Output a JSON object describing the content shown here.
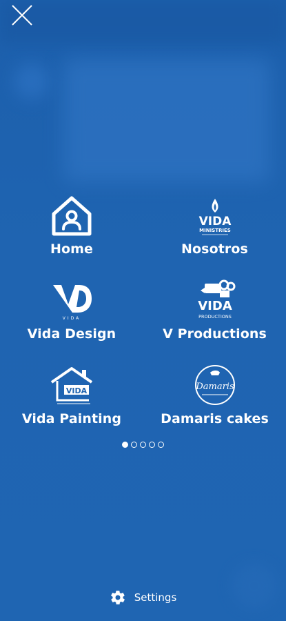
{
  "menu": {
    "items": [
      {
        "label": "Home",
        "icon": "home-user-icon"
      },
      {
        "label": "Nosotros",
        "icon": "vida-ministries-logo",
        "logo_text": "VIDA",
        "logo_subtext": "MINISTRIES"
      },
      {
        "label": "Vida Design",
        "icon": "vida-design-logo",
        "logo_text": "VD",
        "logo_subtext": "VIDA"
      },
      {
        "label": "V Productions",
        "icon": "vida-productions-logo",
        "logo_text": "VIDA",
        "logo_subtext": "PRODUCTIONS"
      },
      {
        "label": "Vida Painting",
        "icon": "vida-painting-logo",
        "logo_text": "VIDA"
      },
      {
        "label": "Damaris cakes",
        "icon": "damaris-cakes-logo",
        "logo_text": "Damaris"
      }
    ]
  },
  "pager": {
    "count": 5,
    "active": 1
  },
  "settings": {
    "label": "Settings",
    "icon": "gear-icon"
  },
  "colors": {
    "background": "#1f64b0",
    "foreground": "#ffffff"
  }
}
